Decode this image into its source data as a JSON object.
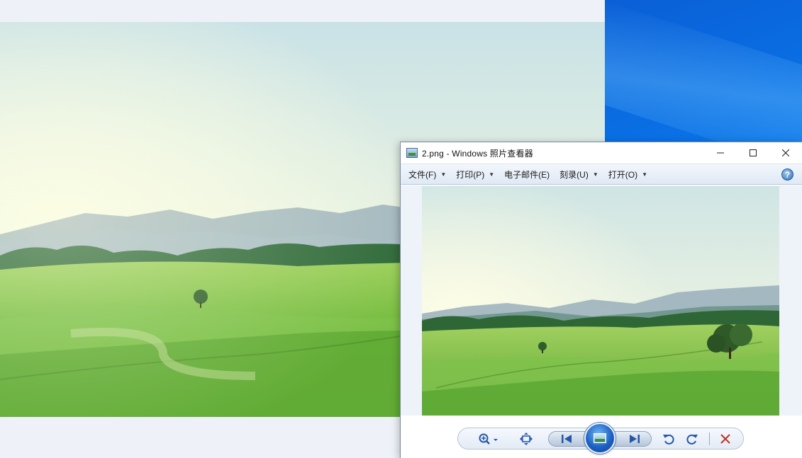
{
  "viewer": {
    "title": "2.png - Windows 照片查看器",
    "icon": "photo-viewer-app-icon",
    "controls": {
      "minimize": "—",
      "maximize": "☐",
      "close": "✕"
    },
    "menu": [
      {
        "label": "文件(F)",
        "has_dropdown": true
      },
      {
        "label": "打印(P)",
        "has_dropdown": true
      },
      {
        "label": "电子邮件(E)",
        "has_dropdown": false
      },
      {
        "label": "刻录(U)",
        "has_dropdown": true
      },
      {
        "label": "打开(O)",
        "has_dropdown": true
      }
    ],
    "help": "?",
    "toolbar": {
      "zoom": "zoom-icon",
      "fit": "actual-size-icon",
      "previous": "previous-icon",
      "slideshow": "slideshow-icon",
      "next": "next-icon",
      "rotate_left": "rotate-counterclockwise-icon",
      "rotate_right": "rotate-clockwise-icon",
      "delete": "delete-icon"
    }
  },
  "colors": {
    "desktop_blue": "#0a76ea",
    "menubar": "#dfe9f5",
    "toolbar_blue": "#2457a8",
    "delete_red": "#c0392b"
  }
}
